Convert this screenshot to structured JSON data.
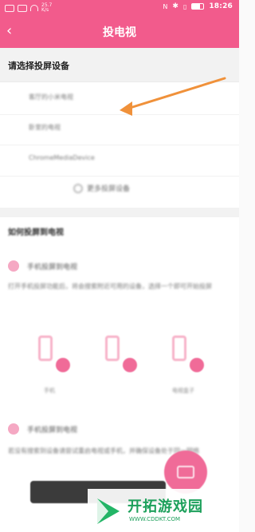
{
  "statusbar": {
    "left_icons": [
      "sim-icon",
      "signal-icon",
      "wifi-icon"
    ],
    "net_speed_top": "25.7",
    "net_speed_bottom": "K/s",
    "time": "18:26",
    "right_icons": [
      "nfc-icon",
      "bluetooth-icon",
      "vibrate-icon",
      "battery-icon"
    ]
  },
  "appbar": {
    "title": "投电视",
    "back_icon": "chevron-left-icon"
  },
  "device_section": {
    "title": "请选择投屏设备",
    "devices": [
      "客厅的小米电视",
      "卧室的电视",
      "ChromeMediaDevice"
    ],
    "more_label": "更多投屏设备"
  },
  "guide_section": {
    "title": "如何投屏到电视",
    "step1_label": "手机投屏到电视",
    "step1_text": "打开手机投屏功能后，将会搜索附近可用的设备，选择一个即可开始投屏",
    "phones": [
      {
        "label": "手机"
      },
      {
        "label": ""
      },
      {
        "label": "电视盒子"
      }
    ],
    "step2_label": "手机投屏到电视",
    "step2_text": "若没有搜索到设备请尝试重启电视或手机，并确保设备处于同一网络",
    "fab_icon": "screen-cast-icon"
  },
  "watermark": {
    "title": "开拓游戏园",
    "url": "WWW.CDDKT.COM"
  },
  "colors": {
    "accent": "#f25b8c",
    "accent_light": "#f5a8c3",
    "arrow": "#f0913a",
    "watermark_green": "#1da05b"
  }
}
